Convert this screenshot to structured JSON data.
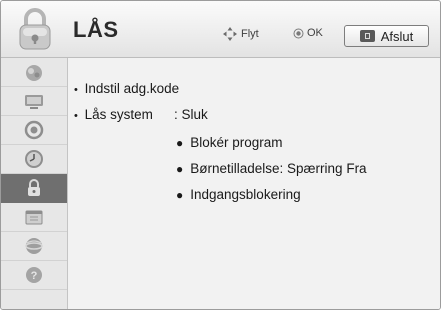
{
  "header": {
    "title": "LÅS",
    "move_hint": "Flyt",
    "ok_hint": "OK",
    "exit_label": "Afslut"
  },
  "sidebar": {
    "items": [
      {
        "icon": "picture-icon"
      },
      {
        "icon": "tv-screen-icon"
      },
      {
        "icon": "speaker-icon"
      },
      {
        "icon": "clock-icon"
      },
      {
        "icon": "lock-icon",
        "active": true
      },
      {
        "icon": "calendar-icon"
      },
      {
        "icon": "network-icon"
      },
      {
        "icon": "help-icon"
      }
    ]
  },
  "menu": {
    "set_password": "Indstil adg.kode",
    "lock_system_label": "Lås system",
    "lock_system_value": ": Sluk",
    "sub_items": [
      {
        "label": "Blokér program"
      },
      {
        "label": "Børnetilladelse: Spærring Fra"
      },
      {
        "label": "Indgangsblokering"
      }
    ]
  },
  "colors": {
    "header_bg": "#eeeeee",
    "active_sidebar": "#6f6f6f",
    "content_bg": "#f2f2f2"
  }
}
